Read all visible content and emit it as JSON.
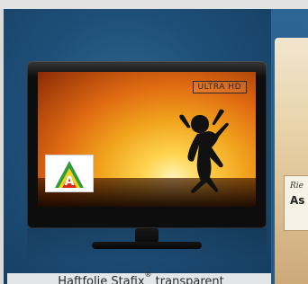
{
  "caption": {
    "prefix": "Haftfolie Stafix",
    "mark": "®",
    "suffix": " transparent"
  },
  "tv": {
    "overlay_label": "ULTRA HD",
    "energy_letter": "A"
  },
  "side_box": {
    "small_text": "Rie",
    "big_text": "As"
  },
  "icons": {
    "energy_label": "energy-label-icon"
  },
  "colors": {
    "background_blue": "#1e4f78",
    "sunset_orange": "#f1a31d",
    "energy_green": "#2e9b3f",
    "energy_yellow": "#f1d11b",
    "energy_red": "#d72a1f"
  }
}
